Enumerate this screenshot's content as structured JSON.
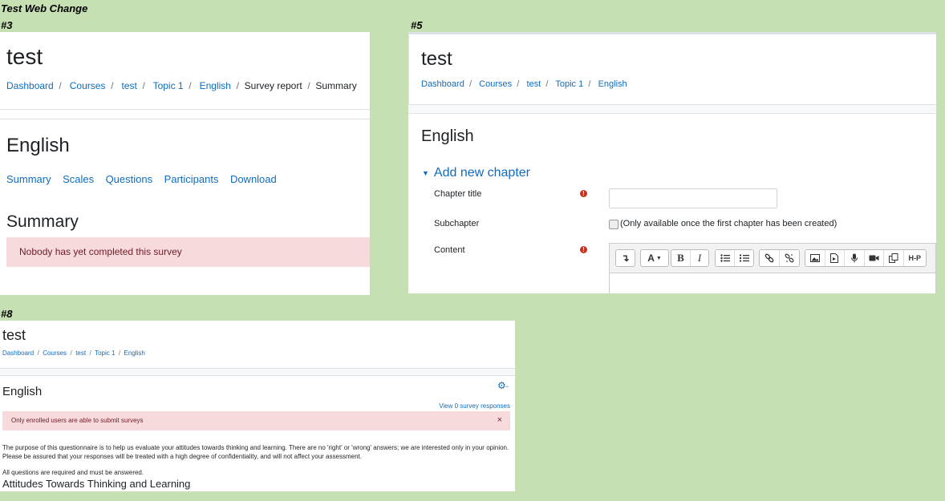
{
  "page_title": "Test Web Change",
  "colors": {
    "background": "#c6e0b4",
    "link": "#0f6cbf",
    "danger_bg": "#f7dadc",
    "danger_text": "#6e1d26"
  },
  "panel3": {
    "label": "#3",
    "course_title": "test",
    "breadcrumbs": [
      "Dashboard",
      "Courses",
      "test",
      "Topic 1",
      "English",
      "Survey report",
      "Summary"
    ],
    "section_title": "English",
    "tabs": [
      "Summary",
      "Scales",
      "Questions",
      "Participants",
      "Download"
    ],
    "summary_heading": "Summary",
    "alert": "Nobody has yet completed this survey"
  },
  "panel5": {
    "label": "#5",
    "course_title": "test",
    "breadcrumbs": [
      "Dashboard",
      "Courses",
      "test",
      "Topic 1",
      "English"
    ],
    "section_title": "English",
    "form_heading": "Add new chapter",
    "chapter_title_label": "Chapter title",
    "chapter_title_value": "",
    "subchapter_label": "Subchapter",
    "subchapter_note": "(Only available once the first chapter has been created)",
    "content_label": "Content",
    "toolbar_icons": [
      "collapse-icon",
      "font-color-icon",
      "bold-icon",
      "italic-icon",
      "unordered-list-icon",
      "ordered-list-icon",
      "link-icon",
      "unlink-icon",
      "image-icon",
      "media-icon",
      "record-audio-icon",
      "record-video-icon",
      "manage-files-icon",
      "h5p-icon"
    ],
    "toolbar_text": {
      "bold": "B",
      "italic": "I",
      "font": "A",
      "h5p": "H-P"
    }
  },
  "panel8": {
    "label": "#8",
    "course_title": "test",
    "breadcrumbs": [
      "Dashboard",
      "Courses",
      "test",
      "Topic 1",
      "English"
    ],
    "section_title": "English",
    "view_responses": "View 0 survey responses",
    "alert": "Only enrolled users are able to submit surveys",
    "close": "×",
    "intro_1": "The purpose of this questionnaire is to help us evaluate your attitudes towards thinking and learning. There are no 'right' or 'wrong' answers; we are interested only in your opinion.",
    "intro_2": "Please be assured that your responses will be treated with a high degree of confidentiality, and will not affect your assessment.",
    "required_note": "All questions are required and must be answered.",
    "section_heading": "Attitudes Towards Thinking and Learning"
  }
}
